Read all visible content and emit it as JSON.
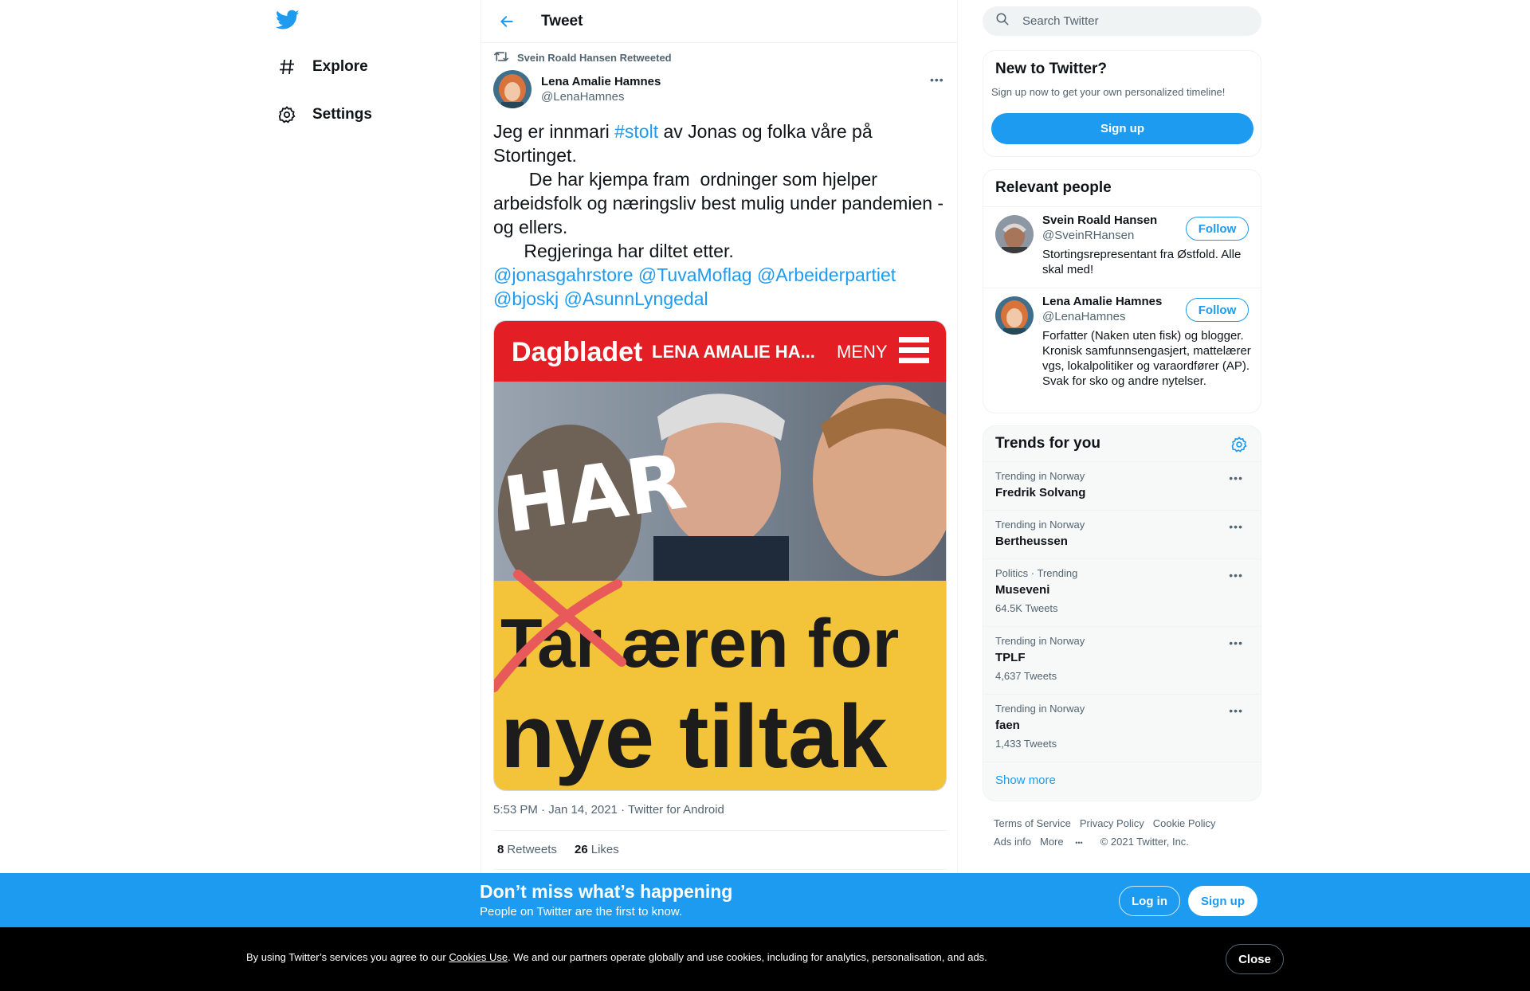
{
  "nav": {
    "explore_label": "Explore",
    "settings_label": "Settings"
  },
  "header": {
    "title": "Tweet"
  },
  "tweet": {
    "retweeted_by": "Svein Roald Hansen Retweeted",
    "author_name": "Lena Amalie Hamnes",
    "author_handle": "@LenaHamnes",
    "text_parts": {
      "p1": "Jeg er innmari ",
      "hashtag": "#stolt",
      "p2": " av Jonas og folka våre på Stortinget.\n       De har kjempa fram  ordninger som hjelper arbeidsfolk og næringsliv best mulig under pandemien - og ellers.\n      Regjeringa har diltet etter.\n",
      "m1": "@jonasgahrstore",
      "m2": "@TuvaMoflag",
      "m3": "@Arbeiderpartiet",
      "m4": "@bjoskj",
      "m5": "@AsunnLyngedal"
    },
    "image": {
      "masthead": "Dagbladet",
      "header_text": "LENA AMALIE HA...",
      "menu_label": "MENY",
      "handwritten": "HAR",
      "headline_line1_struck": "Tar",
      "headline_line1_rest": " æren for",
      "headline_line2": "nye tiltak"
    },
    "timestamp": "5:53 PM · Jan 14, 2021 · Twitter for Android",
    "retweets_count": "8",
    "retweets_label": "Retweets",
    "likes_count": "26",
    "likes_label": "Likes"
  },
  "search": {
    "placeholder": "Search Twitter"
  },
  "new_to_twitter": {
    "title": "New to Twitter?",
    "subtitle": "Sign up now to get your own personalized timeline!",
    "button": "Sign up"
  },
  "relevant_people": {
    "title": "Relevant people",
    "people": [
      {
        "name": "Svein Roald Hansen",
        "handle": "@SveinRHansen",
        "bio": "Stortingsrepresentant fra Østfold. Alle skal med!",
        "button": "Follow"
      },
      {
        "name": "Lena Amalie Hamnes",
        "handle": "@LenaHamnes",
        "bio": "Forfatter (Naken uten fisk) og blogger. Kronisk samfunnsengasjert, mattelærer vgs, lokalpolitiker og varaordfører (AP). Svak for sko og andre nytelser.",
        "button": "Follow"
      }
    ]
  },
  "trends": {
    "title": "Trends for you",
    "items": [
      {
        "context": "Trending in Norway",
        "name": "Fredrik Solvang",
        "count": ""
      },
      {
        "context": "Trending in Norway",
        "name": "Bertheussen",
        "count": ""
      },
      {
        "context": "Politics · Trending",
        "name": "Museveni",
        "count": "64.5K Tweets"
      },
      {
        "context": "Trending in Norway",
        "name": "TPLF",
        "count": "4,637 Tweets"
      },
      {
        "context": "Trending in Norway",
        "name": "faen",
        "count": "1,433 Tweets"
      }
    ],
    "show_more": "Show more"
  },
  "footer": {
    "terms": "Terms of Service",
    "privacy": "Privacy Policy",
    "cookie": "Cookie Policy",
    "ads": "Ads info",
    "more": "More",
    "copyright": "© 2021 Twitter, Inc."
  },
  "bottom_bar": {
    "headline": "Don’t miss what’s happening",
    "subline": "People on Twitter are the first to know.",
    "login": "Log in",
    "signup": "Sign up"
  },
  "cookie_bar": {
    "text_before": "By using Twitter’s services you agree to our ",
    "link": "Cookies Use",
    "text_after": ". We and our partners operate globally and use cookies, including for analytics, personalisation, and ads.",
    "close": "Close"
  },
  "colors": {
    "accent": "#1d9bf0",
    "text_primary": "#0f1419",
    "text_secondary": "#536471",
    "dagbladet_red": "#e31e24",
    "headline_yellow": "#f3c33a"
  },
  "icons": [
    "twitter-logo-icon",
    "hashtag-icon",
    "gear-icon",
    "back-arrow-icon",
    "retweet-icon",
    "more-icon",
    "search-icon"
  ]
}
